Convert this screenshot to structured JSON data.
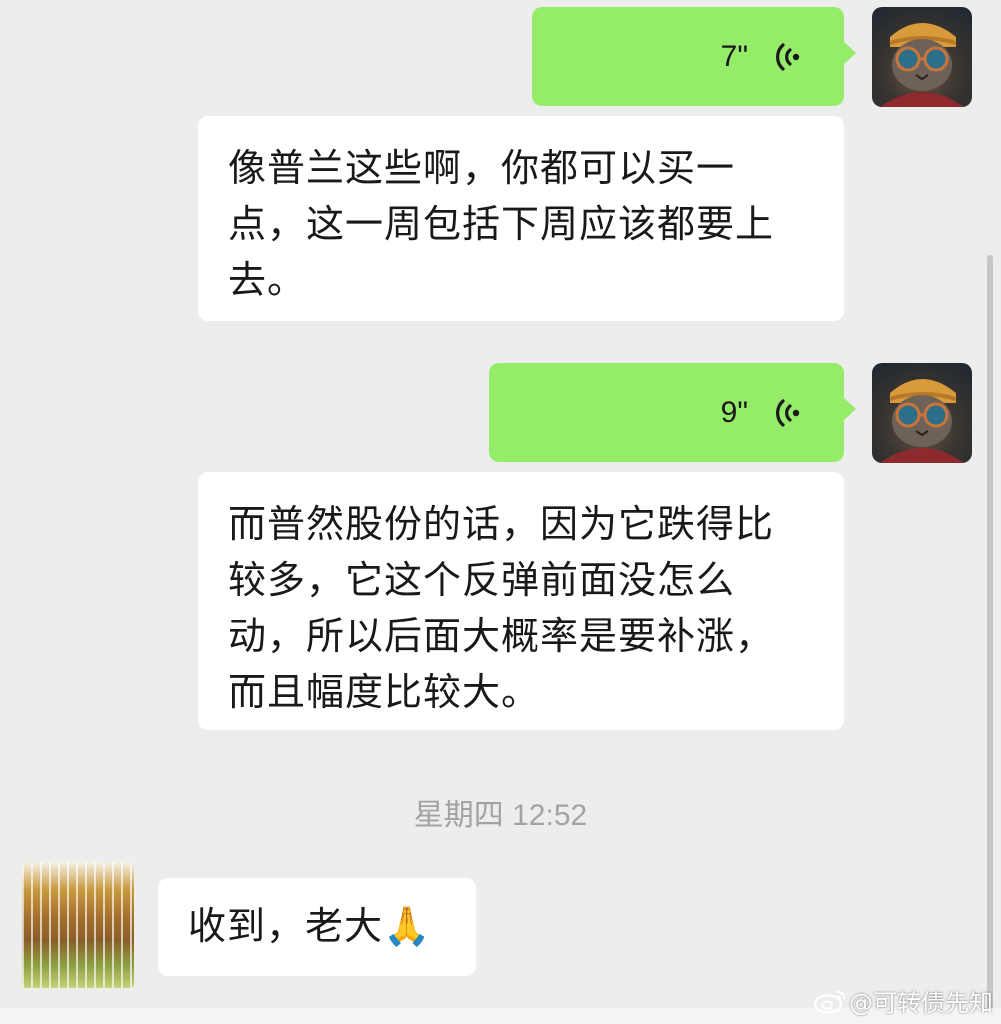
{
  "messages": [
    {
      "type": "voice",
      "sender": "self",
      "duration": "7\""
    },
    {
      "type": "text",
      "sender": "self",
      "lines": [
        "像普兰这些啊，你都可以买一",
        "点，这一周包括下周应该都要上",
        "去。"
      ]
    },
    {
      "type": "voice",
      "sender": "self",
      "duration": "9\""
    },
    {
      "type": "text",
      "sender": "self",
      "lines": [
        "而普然股份的话，因为它跌得比",
        "较多，它这个反弹前面没怎么",
        "动，所以后面大概率是要补涨，",
        "而且幅度比较大。"
      ]
    },
    {
      "type": "text",
      "sender": "other",
      "lines": [
        "收到，老大🙏"
      ]
    }
  ],
  "timestamp": "星期四 12:52",
  "watermark": "@可转债先知",
  "colors": {
    "background": "#ededed",
    "sent_bubble": "#95ec69",
    "text_bubble": "#ffffff",
    "voice_icon": "#191919",
    "timestamp": "#a3a3a3"
  },
  "icons": {
    "voice": "voice-wave-icon",
    "watermark_brand": "weibo-icon"
  }
}
